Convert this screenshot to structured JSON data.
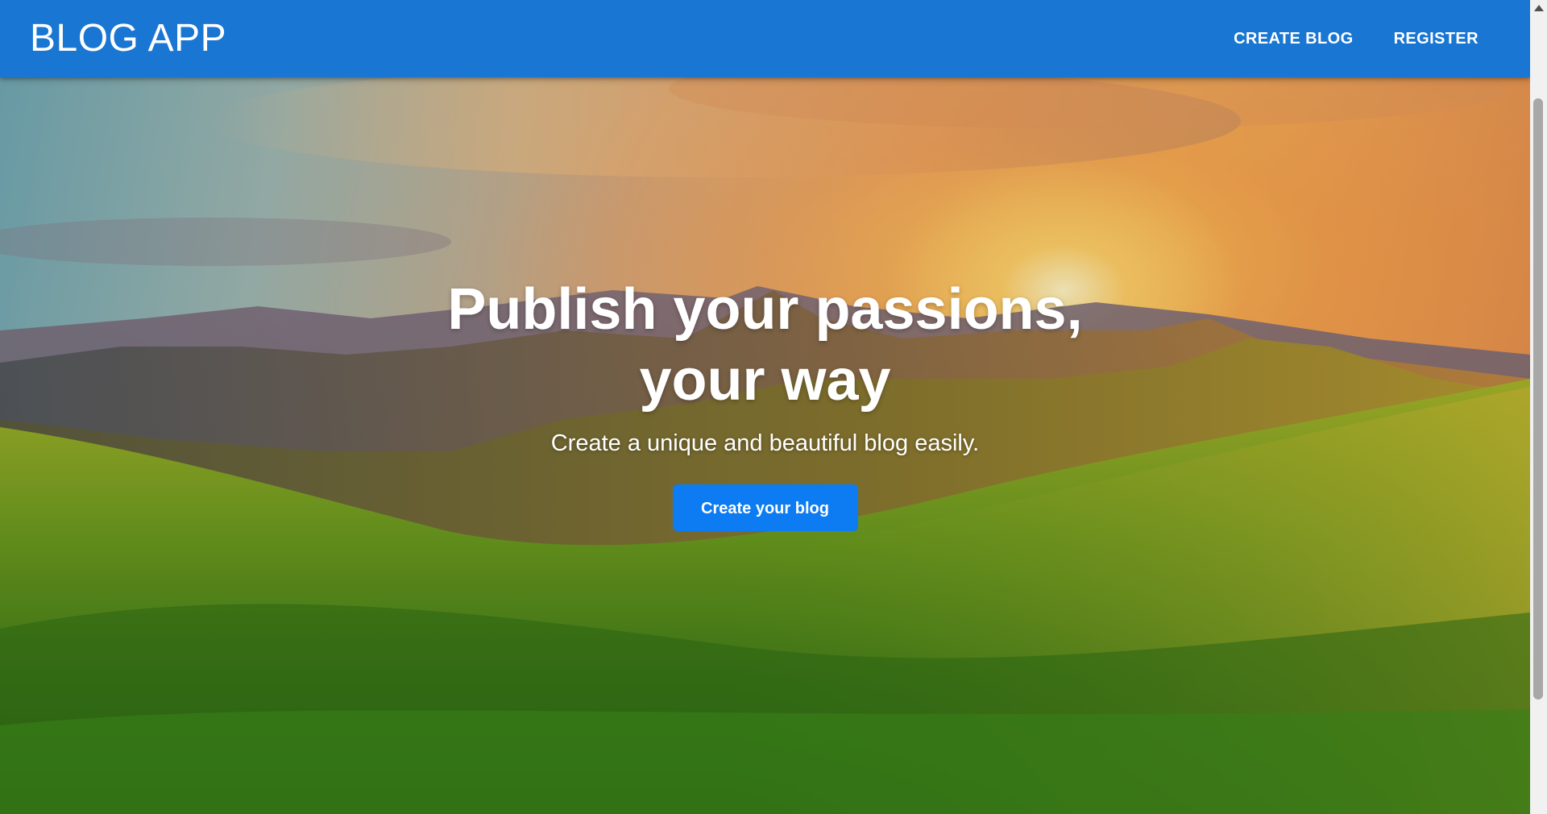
{
  "app": {
    "brand": "BLOG APP"
  },
  "nav": {
    "items": [
      {
        "label": "CREATE BLOG"
      },
      {
        "label": "REGISTER"
      }
    ]
  },
  "hero": {
    "headline_line1": "Publish your passions,",
    "headline_line2": "your way",
    "subtitle": "Create a unique and beautiful blog easily.",
    "cta_label": "Create your blog",
    "background_image": "landscape-sunset-mountains-grass"
  },
  "colors": {
    "appbar": "#1976d2",
    "cta": "#0d7bf2",
    "text": "#ffffff"
  }
}
